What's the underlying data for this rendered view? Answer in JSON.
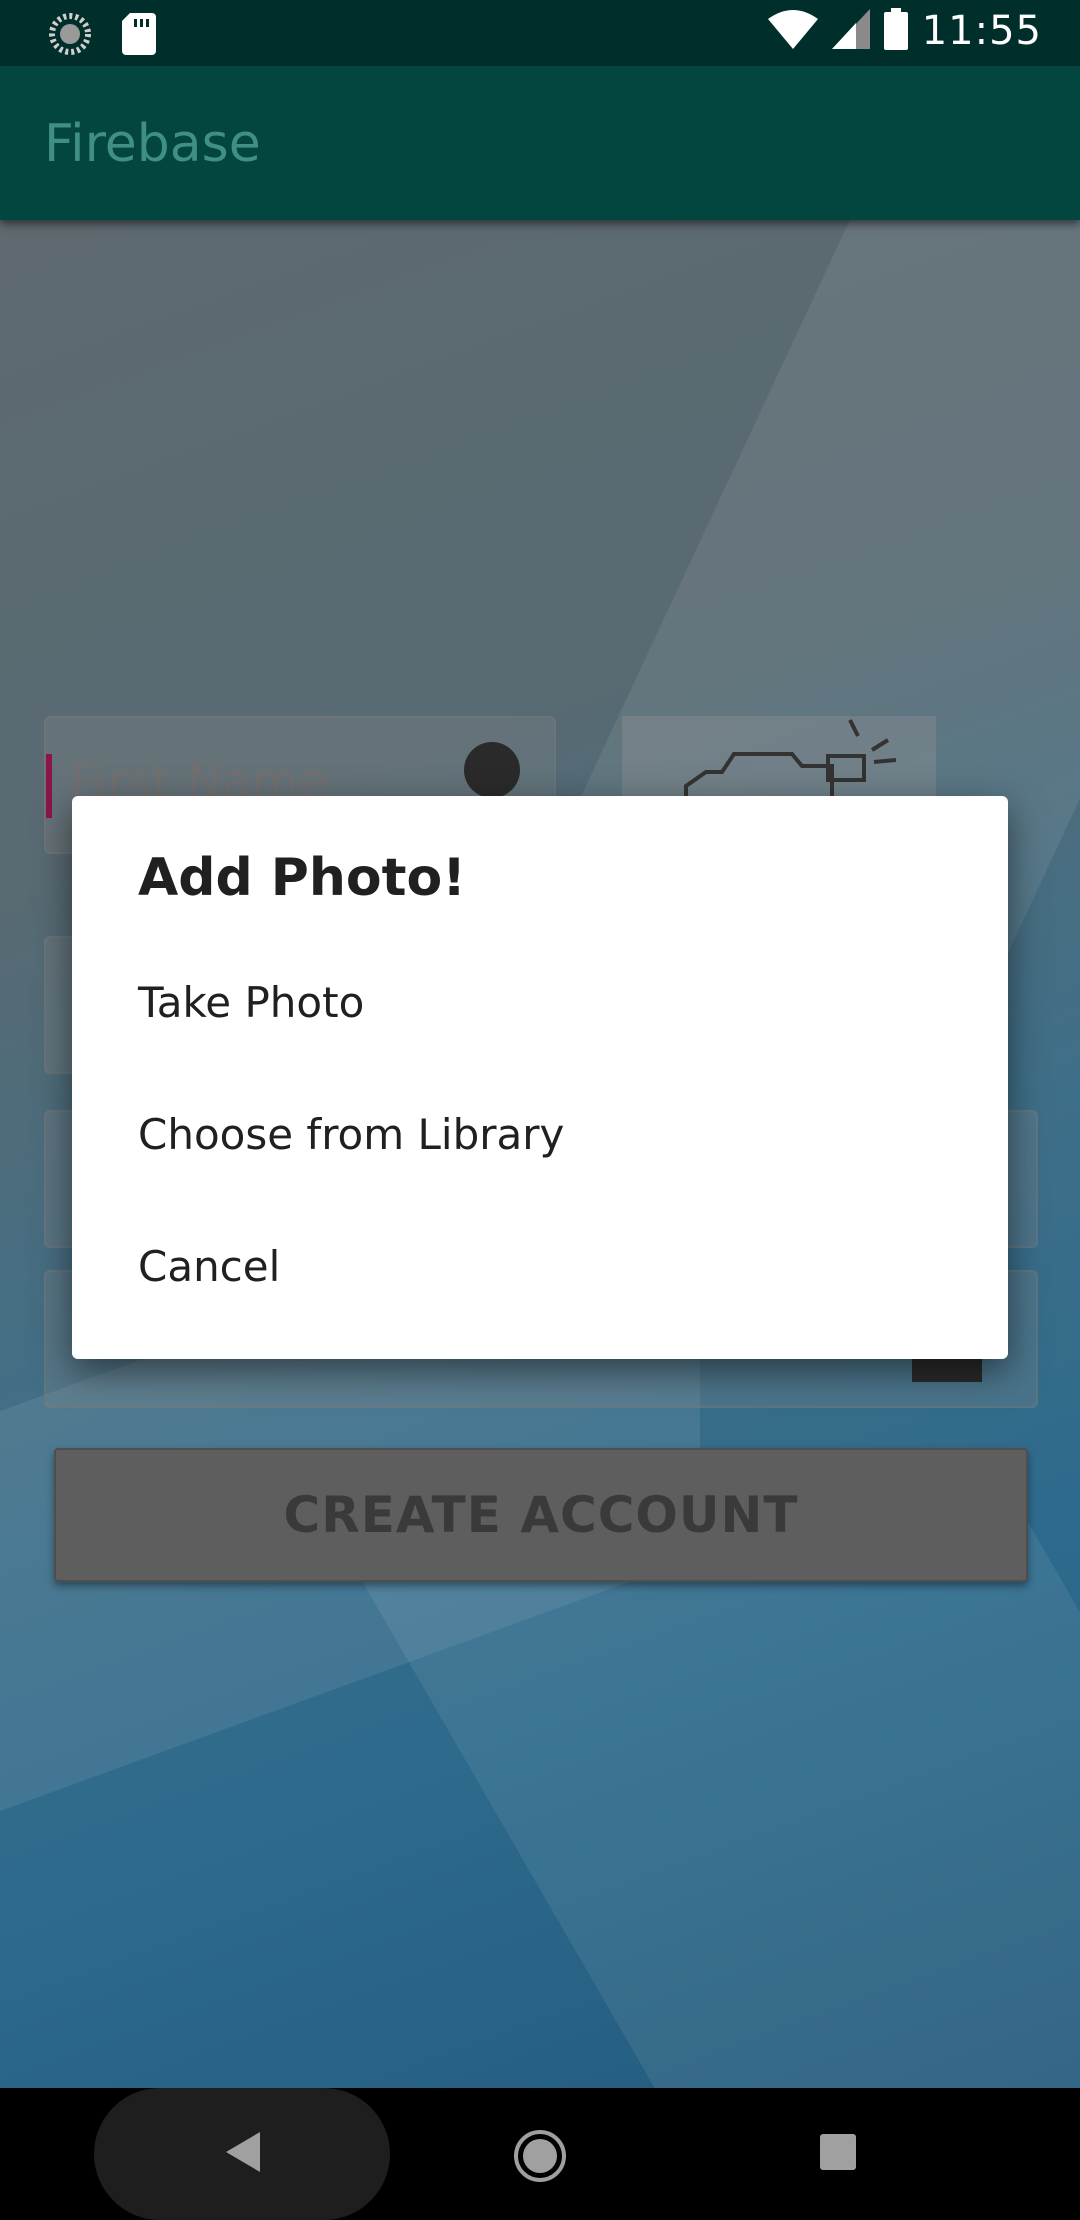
{
  "status_bar": {
    "time": "11:55",
    "icons": [
      "sync-icon",
      "sd-card-icon",
      "wifi-icon",
      "signal-icon",
      "battery-icon"
    ]
  },
  "app_bar": {
    "title": "Firebase"
  },
  "form": {
    "first_name_placeholder": "First Name",
    "create_account_label": "CREATE ACCOUNT"
  },
  "dialog": {
    "title": "Add Photo!",
    "options": [
      "Take Photo",
      "Choose from Library",
      "Cancel"
    ]
  },
  "nav_bar": {
    "buttons": [
      "back-icon",
      "home-icon",
      "recents-icon"
    ]
  },
  "colors": {
    "status_bar": "#002f2b",
    "app_bar": "#03463f",
    "accent": "#8a1648",
    "dialog_bg": "#ffffff"
  }
}
